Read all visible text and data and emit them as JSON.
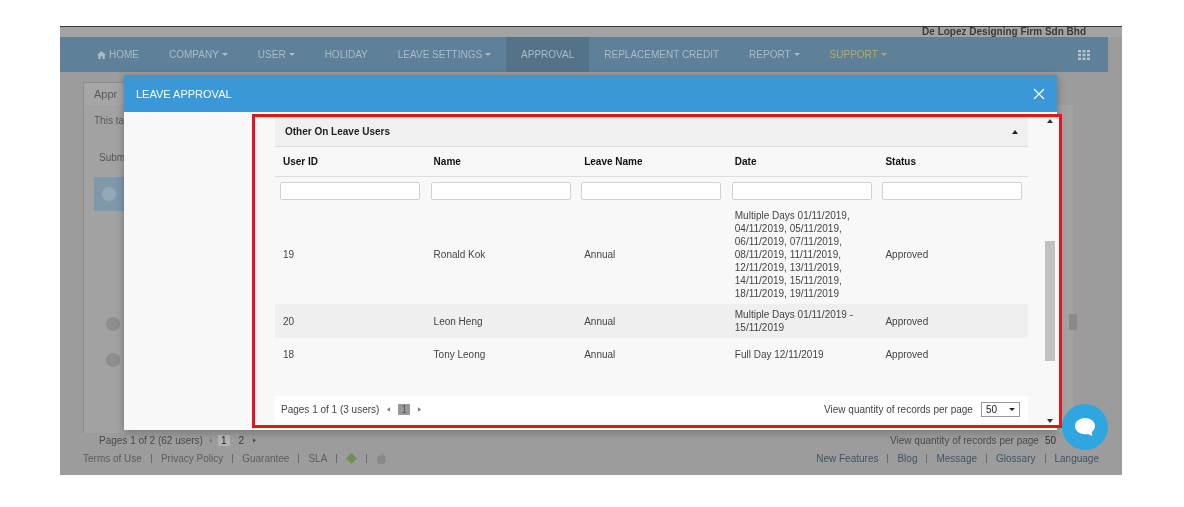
{
  "company_name": "De Lopez Designing Firm Sdn Bhd",
  "nav": [
    {
      "label": "HOME",
      "kind": "home",
      "dropdown": false,
      "selected": false,
      "highlighted": false
    },
    {
      "label": "COMPANY",
      "kind": "text",
      "dropdown": true,
      "selected": false,
      "highlighted": false
    },
    {
      "label": "USER",
      "kind": "text",
      "dropdown": true,
      "selected": false,
      "highlighted": false
    },
    {
      "label": "HOLIDAY",
      "kind": "text",
      "dropdown": false,
      "selected": false,
      "highlighted": false
    },
    {
      "label": "LEAVE SETTINGS",
      "kind": "text",
      "dropdown": true,
      "selected": false,
      "highlighted": false
    },
    {
      "label": "APPROVAL",
      "kind": "text",
      "dropdown": false,
      "selected": true,
      "highlighted": false
    },
    {
      "label": "REPLACEMENT CREDIT",
      "kind": "text",
      "dropdown": false,
      "selected": false,
      "highlighted": false
    },
    {
      "label": "REPORT",
      "kind": "text",
      "dropdown": true,
      "selected": false,
      "highlighted": false
    },
    {
      "label": "SUPPORT",
      "kind": "text",
      "dropdown": true,
      "selected": false,
      "highlighted": true
    }
  ],
  "background_page": {
    "tab": "Appr",
    "description": "This ta",
    "label": "Subm",
    "pagination": {
      "summary": "Pages 1 of 2 (62 users)",
      "pages": [
        {
          "label": "1",
          "selected": true
        },
        {
          "label": "2",
          "selected": false
        }
      ]
    },
    "records_per_page": {
      "label": "View quantity of records per page",
      "value": "50"
    }
  },
  "footer_left": [
    "Terms of Use",
    "Privacy Policy",
    "Guarantee",
    "SLA"
  ],
  "footer_right": [
    "New Features",
    "Blog",
    "Message",
    "Glossary",
    "Language"
  ],
  "modal": {
    "title": "LEAVE APPROVAL",
    "panel": {
      "title": "Other On Leave Users",
      "expanded": true,
      "columns": [
        "User ID",
        "Name",
        "Leave Name",
        "Date",
        "Status"
      ],
      "rows": [
        {
          "cells": [
            "19",
            "Ronald Kok",
            "Annual",
            "Multiple Days 01/11/2019, 04/11/2019, 05/11/2019, 06/11/2019, 07/11/2019, 08/11/2019, 11/11/2019, 12/11/2019, 13/11/2019, 14/11/2019, 15/11/2019, 18/11/2019, 19/11/2019",
            "Approved"
          ]
        },
        {
          "cells": [
            "20",
            "Leon Heng",
            "Annual",
            "Multiple Days 01/11/2019 - 15/11/2019",
            "Approved"
          ]
        },
        {
          "cells": [
            "18",
            "Tony Leong",
            "Annual",
            "Full Day 12/11/2019",
            "Approved"
          ]
        }
      ],
      "pagination": {
        "summary": "Pages 1 of 1 (3 users)",
        "pages": [
          {
            "label": "1",
            "selected": true
          }
        ]
      },
      "records_per_page": {
        "label": "View quantity of records per page",
        "value": "50"
      }
    }
  }
}
